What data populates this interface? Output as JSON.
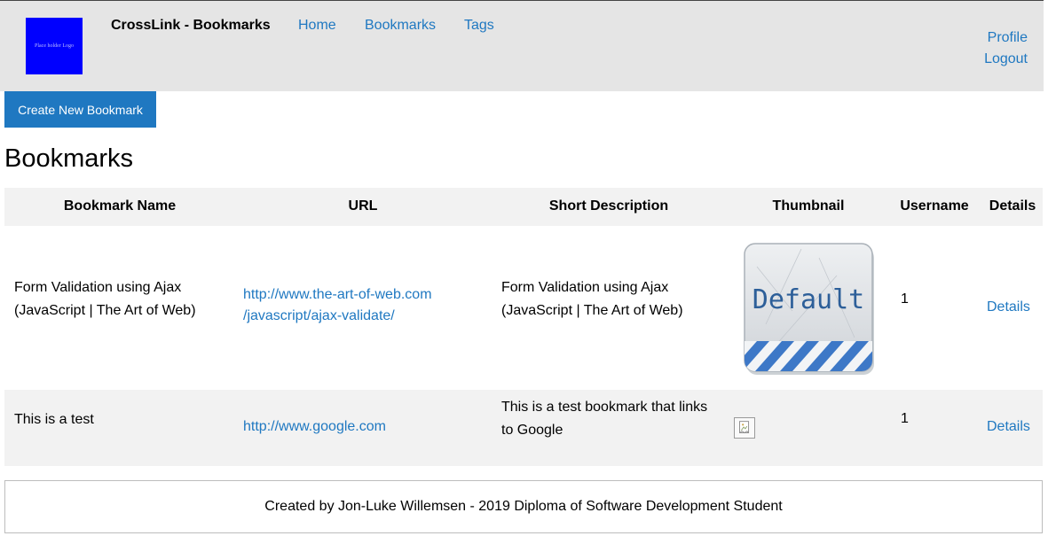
{
  "header": {
    "logo_text": "Place holder Logo",
    "site_title": "CrossLink - Bookmarks",
    "nav": {
      "home": "Home",
      "bookmarks": "Bookmarks",
      "tags": "Tags"
    },
    "user": {
      "profile": "Profile",
      "logout": "Logout"
    }
  },
  "toolbar": {
    "create_label": "Create New Bookmark"
  },
  "page_title": "Bookmarks",
  "table": {
    "headers": [
      "Bookmark Name",
      "URL",
      "Short Description",
      "Thumbnail",
      "Username",
      "Details"
    ],
    "rows": [
      {
        "name_line1": "Form Validation using Ajax",
        "name_line2": "(JavaScript | The Art of Web)",
        "url_line1": "http://www.the-art-of-web.com",
        "url_line2": "/javascript/ajax-validate/",
        "desc_line1": "Form Validation using Ajax",
        "desc_line2": "(JavaScript | The Art of Web)",
        "thumbnail_text": "Default",
        "username": "1",
        "details": "Details"
      },
      {
        "name_line1": "This is a test",
        "url_line1": "http://www.google.com",
        "desc_line1": "This is a test bookmark that links",
        "desc_line2": "to Google",
        "thumbnail_icon": "broken-image-icon",
        "username": "1",
        "details": "Details"
      }
    ]
  },
  "footer": {
    "text": "Created by Jon-Luke Willemsen - 2019 Diploma of Software Development Student"
  },
  "colors": {
    "accent": "#1f78c1",
    "header_bg": "#e5e5e5",
    "table_stripe": "#f2f2f2",
    "logo_bg": "#0000ff"
  }
}
